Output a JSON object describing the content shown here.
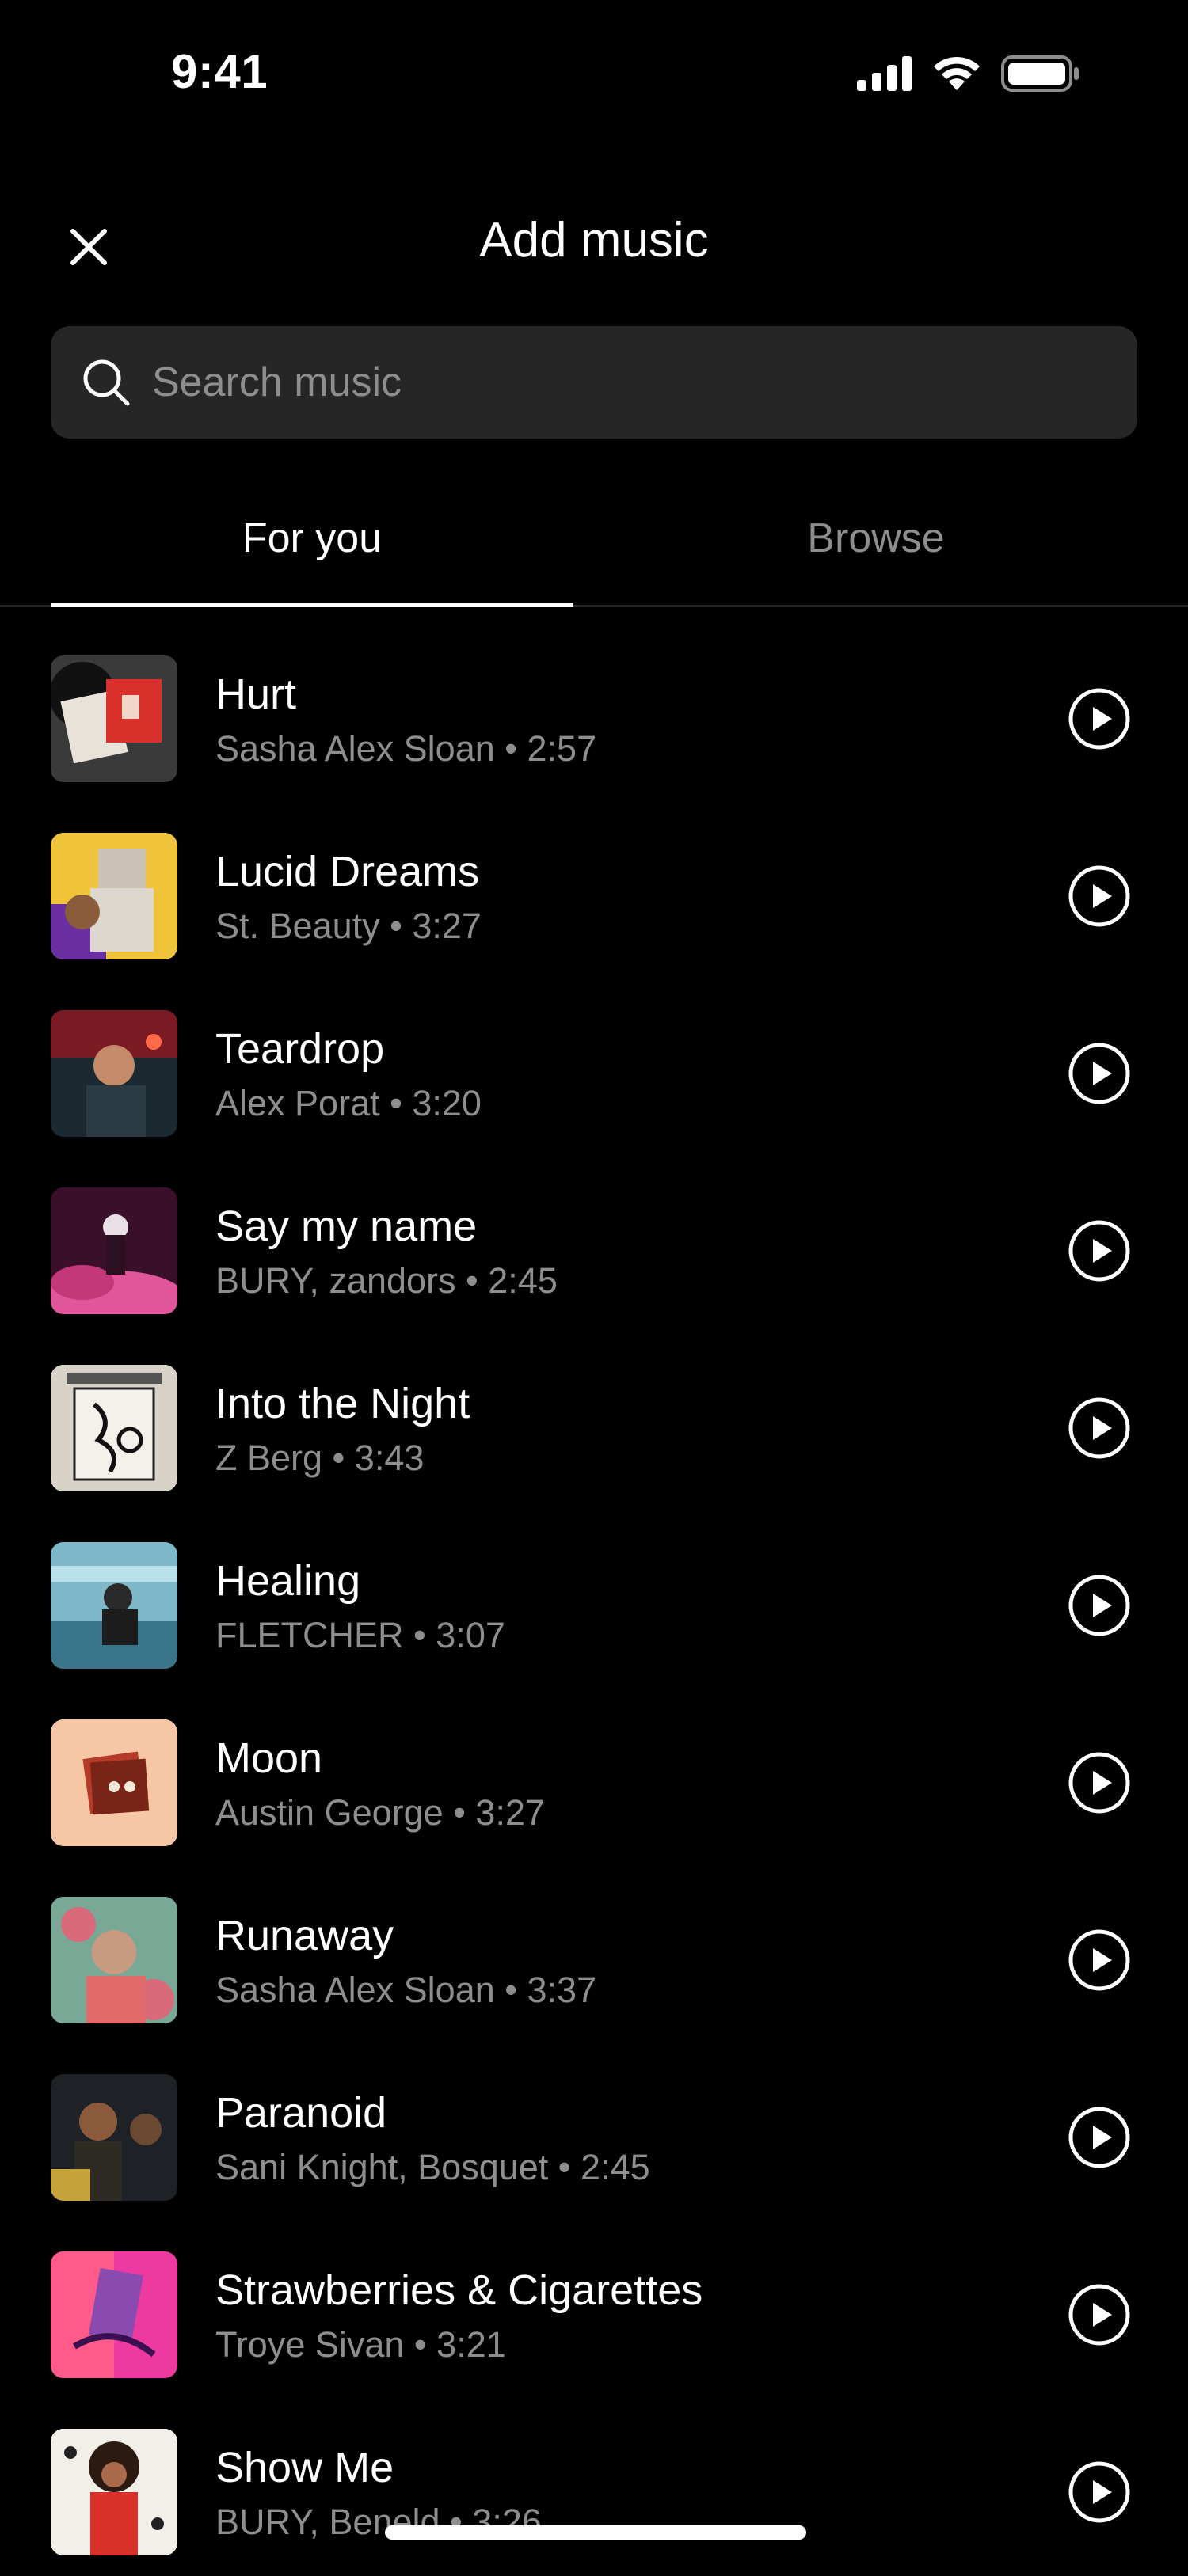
{
  "status_bar": {
    "time": "9:41"
  },
  "header": {
    "title": "Add music"
  },
  "search": {
    "placeholder": "Search music",
    "value": ""
  },
  "tabs": [
    {
      "label": "For you",
      "active": true
    },
    {
      "label": "Browse",
      "active": false
    }
  ],
  "colors": {
    "background": "#000000",
    "surface": "#262626",
    "primary_text": "#ffffff",
    "secondary_text": "#8e8e8e"
  },
  "tracks": [
    {
      "title": "Hurt",
      "meta": "Sasha Alex Sloan • 2:57"
    },
    {
      "title": "Lucid Dreams",
      "meta": "St. Beauty • 3:27"
    },
    {
      "title": "Teardrop",
      "meta": "Alex Porat • 3:20"
    },
    {
      "title": "Say my name",
      "meta": "BURY, zandors • 2:45"
    },
    {
      "title": "Into the Night",
      "meta": "Z Berg • 3:43"
    },
    {
      "title": "Healing",
      "meta": "FLETCHER • 3:07"
    },
    {
      "title": "Moon",
      "meta": "Austin George • 3:27"
    },
    {
      "title": "Runaway",
      "meta": "Sasha Alex Sloan • 3:37"
    },
    {
      "title": "Paranoid",
      "meta": "Sani Knight, Bosquet • 2:45"
    },
    {
      "title": "Strawberries & Cigarettes",
      "meta": "Troye Sivan • 3:21"
    },
    {
      "title": "Show Me",
      "meta": "BURY, Beneld • 3:26"
    }
  ]
}
